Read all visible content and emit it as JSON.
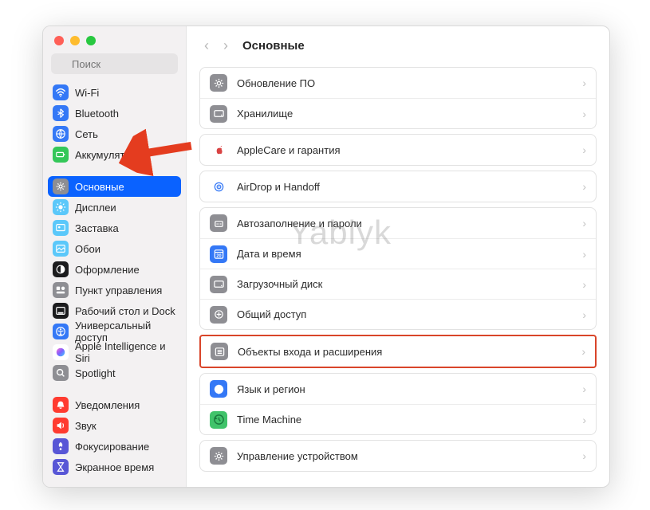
{
  "window": {
    "search_placeholder": "Поиск",
    "header_title": "Основные"
  },
  "sidebar": {
    "items": [
      {
        "label": "Wi-Fi",
        "icon": "wifi",
        "bg": "#3478f6",
        "fg": "#fff"
      },
      {
        "label": "Bluetooth",
        "icon": "bluetooth",
        "bg": "#3478f6",
        "fg": "#fff"
      },
      {
        "label": "Сеть",
        "icon": "globe",
        "bg": "#3478f6",
        "fg": "#fff"
      },
      {
        "label": "Аккумулятор",
        "icon": "battery",
        "bg": "#34c759",
        "fg": "#fff"
      }
    ],
    "items2": [
      {
        "label": "Основные",
        "icon": "gear",
        "bg": "#8e8e93",
        "fg": "#fff",
        "selected": true
      },
      {
        "label": "Дисплеи",
        "icon": "sun",
        "bg": "#5bc8fa",
        "fg": "#fff"
      },
      {
        "label": "Заставка",
        "icon": "screensaver",
        "bg": "#5bc8fa",
        "fg": "#fff"
      },
      {
        "label": "Обои",
        "icon": "wallpaper",
        "bg": "#5bc8fa",
        "fg": "#fff"
      },
      {
        "label": "Оформление",
        "icon": "appearance",
        "bg": "#1c1c1e",
        "fg": "#fff"
      },
      {
        "label": "Пункт управления",
        "icon": "controls",
        "bg": "#8e8e93",
        "fg": "#fff"
      },
      {
        "label": "Рабочий стол и Dock",
        "icon": "dock",
        "bg": "#1c1c1e",
        "fg": "#fff"
      },
      {
        "label": "Универсальный доступ",
        "icon": "accessibility",
        "bg": "#3478f6",
        "fg": "#fff"
      },
      {
        "label": "Apple Intelligence и Siri",
        "icon": "siri",
        "bg": "#ffffff",
        "fg": "#000"
      },
      {
        "label": "Spotlight",
        "icon": "search",
        "bg": "#8e8e93",
        "fg": "#fff"
      }
    ],
    "items3": [
      {
        "label": "Уведомления",
        "icon": "bell",
        "bg": "#ff3b30",
        "fg": "#fff"
      },
      {
        "label": "Звук",
        "icon": "sound",
        "bg": "#ff3b30",
        "fg": "#fff"
      },
      {
        "label": "Фокусирование",
        "icon": "focus",
        "bg": "#5856d6",
        "fg": "#fff"
      },
      {
        "label": "Экранное время",
        "icon": "hourglass",
        "bg": "#5856d6",
        "fg": "#fff"
      }
    ]
  },
  "main": {
    "groups": [
      {
        "rows": [
          {
            "label": "Обновление ПО",
            "icon": "gear",
            "bg": "#8e8e93"
          },
          {
            "label": "Хранилище",
            "icon": "disk",
            "bg": "#8e8e93"
          }
        ]
      },
      {
        "rows": [
          {
            "label": "AppleCare и гарантия",
            "icon": "apple",
            "bg": "#ffffff"
          }
        ]
      },
      {
        "rows": [
          {
            "label": "AirDrop и Handoff",
            "icon": "airdrop",
            "bg": "#ffffff"
          }
        ]
      },
      {
        "rows": [
          {
            "label": "Автозаполнение и пароли",
            "icon": "password",
            "bg": "#8e8e93"
          },
          {
            "label": "Дата и время",
            "icon": "calendar",
            "bg": "#3478f6"
          },
          {
            "label": "Загрузочный диск",
            "icon": "disk",
            "bg": "#8e8e93"
          },
          {
            "label": "Общий доступ",
            "icon": "share",
            "bg": "#8e8e93"
          }
        ]
      },
      {
        "highlight": true,
        "rows": [
          {
            "label": "Объекты входа и расширения",
            "icon": "list",
            "bg": "#8e8e93"
          }
        ]
      },
      {
        "rows": [
          {
            "label": "Язык и регион",
            "icon": "globe2",
            "bg": "#3478f6"
          },
          {
            "label": "Time Machine",
            "icon": "timemachine",
            "bg": "#40c36a"
          }
        ]
      },
      {
        "rows": [
          {
            "label": "Управление устройством",
            "icon": "gear",
            "bg": "#8e8e93"
          }
        ]
      }
    ]
  },
  "watermark": "Yablyk"
}
